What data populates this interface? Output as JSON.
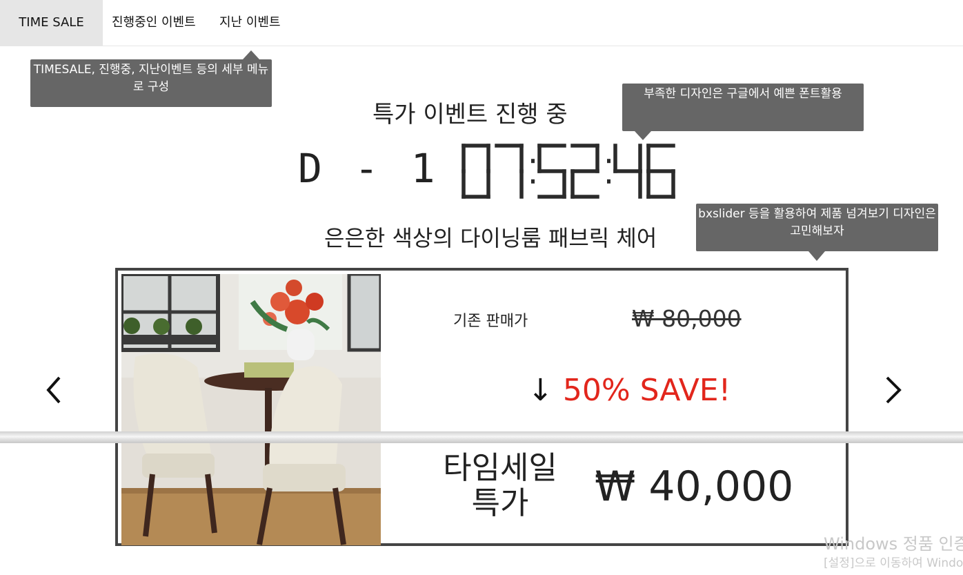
{
  "tabs": [
    {
      "label": "TIME SALE",
      "active": true
    },
    {
      "label": "진행중인 이벤트",
      "active": false
    },
    {
      "label": "지난 이벤트",
      "active": false
    }
  ],
  "tooltips": {
    "menu": "TIMESALE, 진행중, 지난이벤트 등의 세부 메뉴로 구성",
    "font": "부족한 디자인은 구글에서 예쁜 폰트활용",
    "slider": "bxslider 등을 활용하여 제품 넘겨보기 디자인은 고민해보자"
  },
  "event": {
    "title": "특가 이벤트 진행 중",
    "dday": "D - 1",
    "timer": "07:52:46"
  },
  "product": {
    "title": "은은한 색상의 다이닝룸 패브릭 체어",
    "original_label": "기존 판매가",
    "original_price": "₩ 80,000",
    "save_arrow": "↓",
    "save_text": "50% SAVE!",
    "sale_label_line1": "타임세일",
    "sale_label_line2": "특가",
    "sale_price": "₩ 40,000"
  },
  "icons": {
    "prev": "chevron-left-icon",
    "next": "chevron-right-icon"
  },
  "colors": {
    "accent_red": "#e2261c",
    "tooltip_bg": "#666666",
    "active_tab_bg": "#e6e6e6"
  },
  "watermark": {
    "line1": "Windows 정품 인증",
    "line2": "[설정]으로 이동하여 Windows"
  }
}
